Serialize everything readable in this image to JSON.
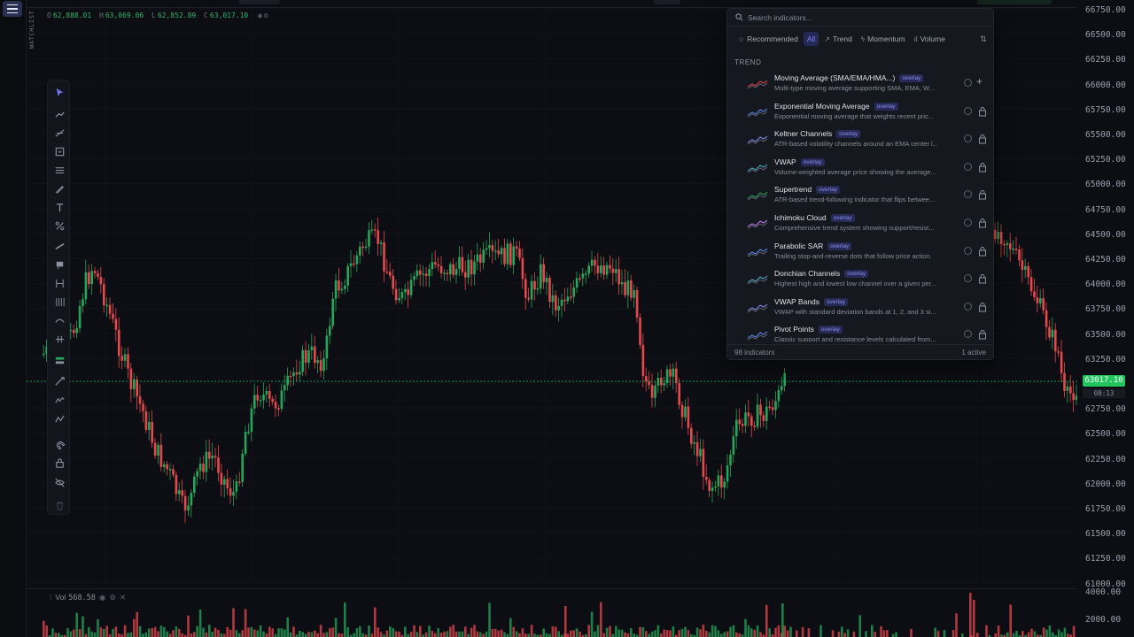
{
  "sidebar": {
    "watchlist_label": "WATCHLIST"
  },
  "ohlc": {
    "o_label": "O",
    "o": "62,888.01",
    "h_label": "H",
    "h": "63,069.06",
    "l_label": "L",
    "l": "62,852.89",
    "c_label": "C",
    "c": "63,017.10"
  },
  "price_axis": {
    "ticks": [
      "66750.00",
      "66500.00",
      "66250.00",
      "66000.00",
      "65750.00",
      "65500.00",
      "65250.00",
      "65000.00",
      "64750.00",
      "64500.00",
      "64250.00",
      "64000.00",
      "63750.00",
      "63500.00",
      "63250.00",
      "63000.00",
      "62750.00",
      "62500.00",
      "62250.00",
      "62000.00",
      "61750.00",
      "61500.00",
      "61250.00",
      "61000.00"
    ],
    "last_price": "63017.10",
    "countdown": "08:13",
    "volume_ticks": [
      "4000.00",
      "2000.00"
    ]
  },
  "volume": {
    "label": "Vol",
    "value": "568.58"
  },
  "indicators": {
    "search_placeholder": "Search indicators...",
    "tabs": [
      {
        "label": "Recommended",
        "icon": "star-icon"
      },
      {
        "label": "All",
        "icon": ""
      },
      {
        "label": "Trend",
        "icon": "trend-icon"
      },
      {
        "label": "Momentum",
        "icon": "momentum-icon"
      },
      {
        "label": "Volume",
        "icon": "volume-icon"
      }
    ],
    "active_tab": "All",
    "section": "TREND",
    "items": [
      {
        "name": "Moving Average (SMA/EMA/HMA...)",
        "badge": "overlay",
        "desc": "Multi-type moving average supporting SMA, EMA, W..."
      },
      {
        "name": "Exponential Moving Average",
        "badge": "overlay",
        "desc": "Exponential moving average that weights recent pric..."
      },
      {
        "name": "Keltner Channels",
        "badge": "overlay",
        "desc": "ATR-based volatility channels around an EMA center l..."
      },
      {
        "name": "VWAP",
        "badge": "overlay",
        "desc": "Volume-weighted average price showing the average..."
      },
      {
        "name": "Supertrend",
        "badge": "overlay",
        "desc": "ATR-based trend-following indicator that flips betwee..."
      },
      {
        "name": "Ichimoku Cloud",
        "badge": "overlay",
        "desc": "Comprehensive trend system showing support/resist..."
      },
      {
        "name": "Parabolic SAR",
        "badge": "overlay",
        "desc": "Trailing stop-and-reverse dots that follow price action."
      },
      {
        "name": "Donchian Channels",
        "badge": "overlay",
        "desc": "Highest high and lowest low channel over a given per..."
      },
      {
        "name": "VWAP Bands",
        "badge": "overlay",
        "desc": "VWAP with standard deviation bands at 1, 2, and 3 si..."
      },
      {
        "name": "Pivot Points",
        "badge": "overlay",
        "desc": "Classic support and resistance levels calculated from..."
      }
    ],
    "count_label": "98 indicators",
    "active_label": "1 active"
  },
  "colors": {
    "up": "#26a65b",
    "down": "#e5484d",
    "accent": "#5057d9",
    "last_price": "#23c55e"
  }
}
